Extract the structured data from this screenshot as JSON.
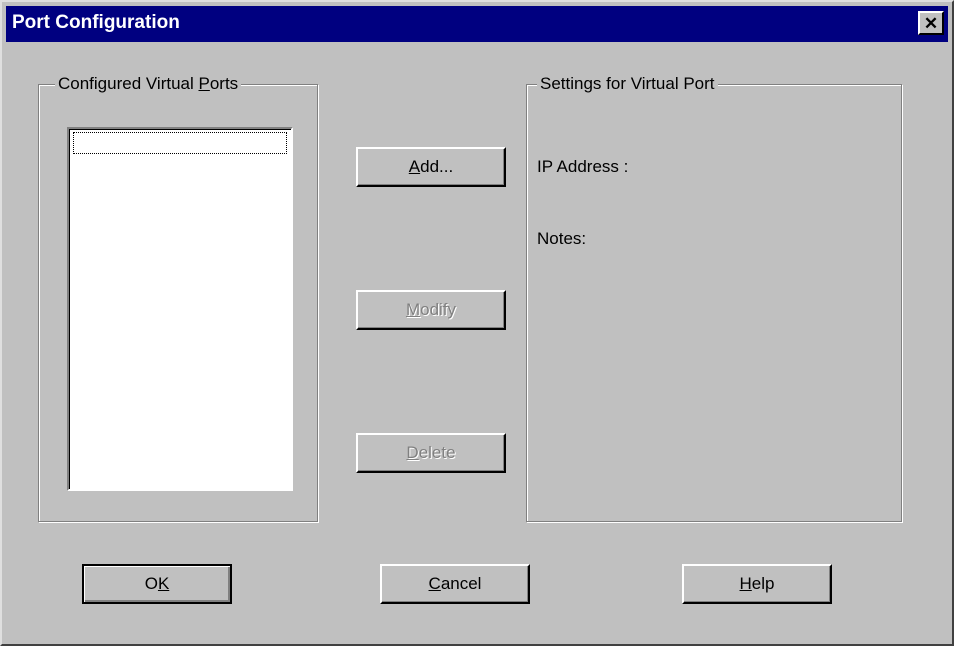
{
  "window": {
    "title": "Port Configuration",
    "close_symbol": "✕"
  },
  "ports_group": {
    "legend_pre": "Configured Virtual ",
    "legend_key": "P",
    "legend_post": "orts",
    "items": []
  },
  "buttons": {
    "add": {
      "key": "A",
      "rest": "dd...",
      "enabled": true
    },
    "modify": {
      "key": "M",
      "rest": "odify",
      "enabled": false
    },
    "delete": {
      "key": "D",
      "rest": "elete",
      "enabled": false
    },
    "ok": {
      "pre": "O",
      "key": "K",
      "rest": ""
    },
    "cancel": {
      "key": "C",
      "rest": "ancel"
    },
    "help": {
      "key": "H",
      "rest": "elp"
    }
  },
  "settings_group": {
    "legend": "Settings for Virtual Port",
    "ip_label": "IP Address :",
    "notes_label": "Notes:"
  },
  "icons": {
    "close": "close-icon"
  }
}
